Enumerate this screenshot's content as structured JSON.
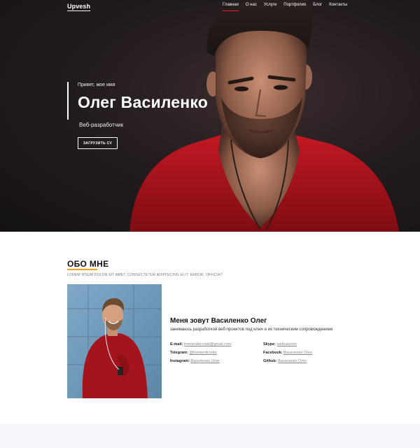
{
  "header": {
    "brand": "Upvesh",
    "nav": [
      {
        "label": "Главная",
        "active": true
      },
      {
        "label": "О нас",
        "active": false
      },
      {
        "label": "Услуги",
        "active": false
      },
      {
        "label": "Портфолио",
        "active": false
      },
      {
        "label": "Блог",
        "active": false
      },
      {
        "label": "Контакты",
        "active": false
      }
    ]
  },
  "hero": {
    "greeting": "Привет, мое имя",
    "name": "Олег Василенко",
    "role": "Веб-разработчик",
    "cv_button": "ЗАГРУЗИТЬ CV"
  },
  "about": {
    "title": "ОБО МНЕ",
    "subtitle": "LOREM IPSUM DOLOR SIT AMET, CONSECTETUR ADIPISICING ELIT. ERROR, OFFICIA?",
    "heading": "Меня зовут Василенко Олег",
    "description": "занимаюсь разработкой веб-проектов под ключ и их техническим сопровождением",
    "contacts_left": [
      {
        "label": "E-mail:",
        "value": "frontendercode@gmail.com"
      },
      {
        "label": "Telegram:",
        "value": "@frontendcoder"
      },
      {
        "label": "Instagram:",
        "value": "Василенко Олег"
      }
    ],
    "contacts_right": [
      {
        "label": "Skype:",
        "value": "webrabcom"
      },
      {
        "label": "Facebook:",
        "value": "Василенко Олег"
      },
      {
        "label": "Github:",
        "value": "Василенко Олег"
      }
    ]
  },
  "colors": {
    "accent_underline": "#f2a31b",
    "nav_active": "#e0202a",
    "hero_shirt": "#b8141c"
  }
}
